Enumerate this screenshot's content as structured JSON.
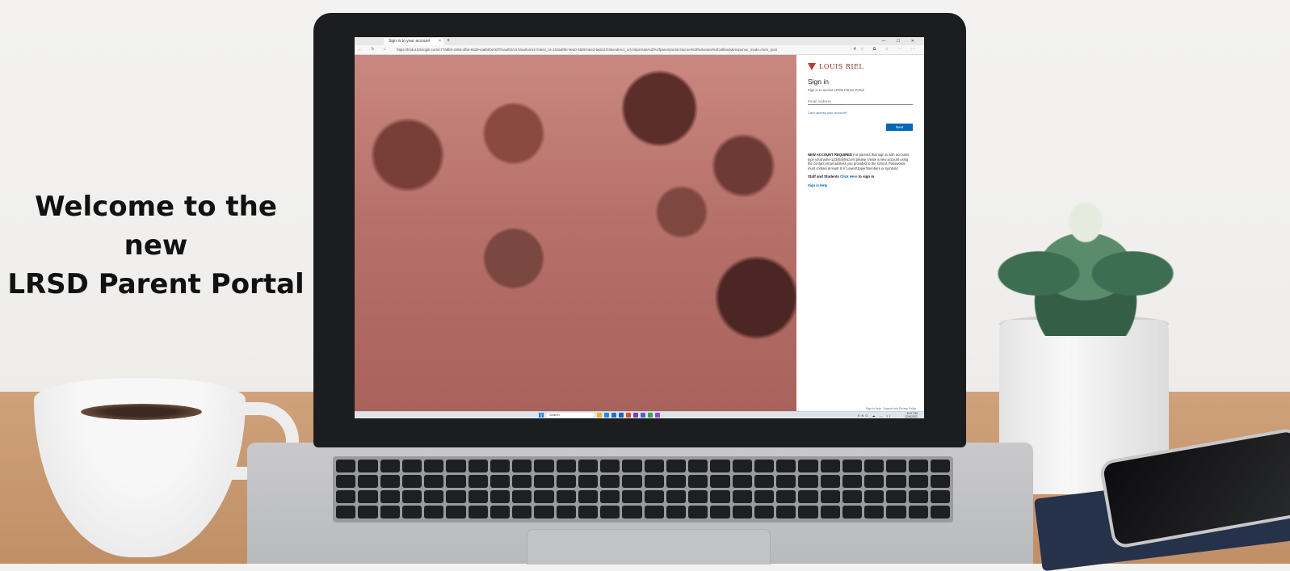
{
  "headline": {
    "line1": "Welcome to the new",
    "line2": "LRSD Parent Portal"
  },
  "browser": {
    "tab_title": "Sign in to your account",
    "tab_close": "×",
    "new_tab": "+",
    "window_controls": "— ☐ ✕",
    "nav_icons": "←  ↻  ⌂",
    "url": "https://lrsdut.b2clogin.com/c77a8b9-2066-4fb5-8439-4a6b0be0d7f/oauth2/v2.0/authorize?client_id=153a4f6b-0ea0-4589-b5e2-beb21f10&redirect_uri=https%3a%2f%2fparentportal.lrsd.net%2ffederated%2fcallback&response_mode=form_post",
    "toolbar_icons": "A☆ ⧉ ☆ ⋯ ⋯"
  },
  "signin": {
    "logo_text": "LOUIS RIEL",
    "title": "Sign in",
    "subtitle": "Sign in to access LRSD Parent Portal",
    "email_placeholder": "Email Address",
    "forgot_link": "Can't access your account?",
    "next_label": "Next",
    "notice_bold": "NEW ACCOUNT REQUIRED",
    "notice_text": " For parents that sign in with accounts type yourname-12345@lrsd.net please create a new account using the contact email address you provided to the school. Passwords must contain at least 8 of Lower/Upper/Numbers or symbols.",
    "staff_prefix": "Staff and Students ",
    "staff_link": "Click Here",
    "staff_suffix": " to sign in",
    "help_link": "Sign in Help",
    "footer": "Sign in Help · Support Info       Privacy Policy"
  },
  "taskbar": {
    "search_placeholder": "Search",
    "tray": "ENG ☁ ◡ ))",
    "time": "8:47 PM",
    "date": "12/6/2022",
    "apps": [
      {
        "name": "file-explorer-app-icon",
        "color": "#e8b33a"
      },
      {
        "name": "edge-app-icon",
        "color": "#1f8de0"
      },
      {
        "name": "word-app-icon",
        "color": "#2b6cd0"
      },
      {
        "name": "outlook-app-icon",
        "color": "#1e63c4"
      },
      {
        "name": "powerpoint-app-icon",
        "color": "#d4502a"
      },
      {
        "name": "onenote-app-icon",
        "color": "#7b3fb8"
      },
      {
        "name": "teams-app-icon",
        "color": "#5b5fc7"
      },
      {
        "name": "chrome-app-icon",
        "color": "#3aa356"
      },
      {
        "name": "store-app-icon",
        "color": "#8a4fd0"
      }
    ]
  },
  "colors": {
    "accent": "#0067b8",
    "brand": "#8b2b23",
    "hero_overlay": "#c27d76"
  }
}
